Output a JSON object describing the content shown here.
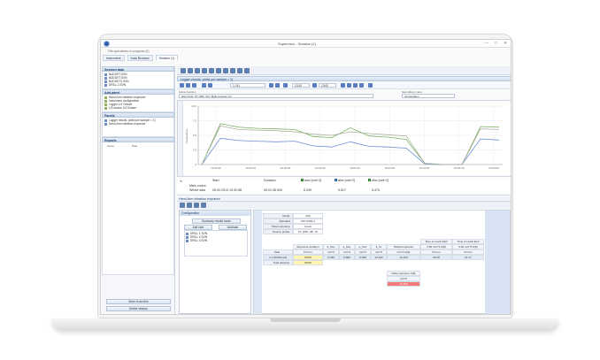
{
  "app": {
    "title": "Supervisor - Session (1)",
    "subtitle": "File operations in progress (0)",
    "tabs": [
      "Instrument",
      "Data Browser",
      "Session (1)"
    ],
    "active_tab": 2
  },
  "sidebar": {
    "session_data": {
      "title": "Session data",
      "items": [
        "BUDGET.SVN",
        "BUDGET.SVN",
        "BUDGET2.SVN",
        "DRILL 2.SVN"
      ]
    },
    "add_panel": {
      "title": "Add panel",
      "items": [
        "Hand-Arm vibration exposure",
        "Instrument configuration",
        "Logger 1/1 Octave",
        "1/3 octave 1/3 Octave"
      ]
    },
    "panels": {
      "title": "Panels",
      "items": [
        "Logger results, plotsi per sample = 1]",
        "Hand-Arm vibration exposure"
      ]
    },
    "reports": {
      "title": "Reports",
      "columns": [
        "Name",
        "Date"
      ]
    },
    "move_archive": "Move to archive",
    "delete_session": "Delete session"
  },
  "logger": {
    "title": "Logger results, plotsi per sample = 1]",
    "position": "1 / 81",
    "time_start": "13:30",
    "time_end": "13:00",
    "active_function_label": "Active function",
    "active_function": "ahw (CH1, PT (WR, Xh), Multi sources (1))",
    "secondary_label": "Secondary y axis",
    "secondary_value": "Acceleration"
  },
  "chart_data": {
    "type": "line",
    "x": [
      "10:03:30",
      "10:03:40",
      "10:03:50",
      "10:04:00",
      "10:04:10",
      "10:04:20",
      "10:04:30",
      "10:04:40",
      "10:04:50"
    ],
    "ylabel": "Acceleration",
    "yticks": [
      "10.0",
      "7.5",
      "5.0",
      "2.5",
      "0"
    ],
    "series": [
      {
        "name": "ahw (CH1)",
        "color": "#7ab36a",
        "values": [
          0.0,
          7.0,
          6.4,
          6.2,
          6.1,
          6.0,
          4.8,
          4.6,
          6.3,
          4.9,
          4.7,
          4.3,
          0.2,
          0.0,
          0.0,
          6.5,
          6.4
        ]
      },
      {
        "name": "ahw (CH2)",
        "color": "#6b8fd6",
        "values": [
          0.0,
          4.5,
          4.1,
          4.0,
          3.9,
          4.0,
          3.2,
          3.0,
          3.9,
          3.1,
          3.0,
          2.8,
          0.1,
          0.0,
          0.0,
          4.4,
          4.2
        ]
      },
      {
        "name": "ahw (CH3)",
        "color": "#aab09a",
        "values": [
          0.0,
          6.6,
          6.0,
          5.9,
          5.8,
          5.6,
          5.2,
          5.0,
          5.6,
          5.3,
          5.1,
          4.9,
          0.2,
          0.0,
          0.0,
          6.1,
          6.0
        ]
      }
    ]
  },
  "cursor_table": {
    "headers": [
      "Start",
      "Duration",
      "ahw [m/s^2]",
      "ahw [m/s^2]",
      "ahw [m/s^2]"
    ],
    "main_cursor_label": "Main cursor",
    "whole_data_label": "Whole data",
    "whole_data": [
      "26.09.2013 10:02:58",
      "00:01:38.000",
      "5.339",
      "9.817",
      "5.470"
    ]
  },
  "hand_arm": {
    "title": "Hand-Arm vibration exposure",
    "config_tab": "Configuration",
    "summary_label": "Summary results mode",
    "add_user": "Add user",
    "add_task": "Add task",
    "tasks": [
      "DRILL 1.SVN",
      "DRILL 2.SVN",
      "DRILL 3.SVN"
    ]
  },
  "exposure_grid": {
    "mode_label": "Mode:",
    "mode_value": "A(8)",
    "standard_label": "Standard",
    "standard_value": "ISO 5349-2",
    "show_exposure_label": "Show exposure",
    "show_exposure_value": "levels",
    "source_profile_label": "Source profile:",
    "source_profile_value": "P1 (WR, Wh, W",
    "task_label": "Task",
    "total_duration_label": "Total duration:",
    "col_headers": [
      "Exposure duration",
      "a_hwx",
      "a_hwy",
      "a_hwz",
      "a_hv",
      "Partial exposure",
      "Time to reach EAV",
      "Time to reach ELV"
    ],
    "col_units": [
      "hh:mm",
      "m/s^2",
      "m/s^2",
      "m/s^2",
      "m/s^2",
      "m/s^2 A(8)",
      "2.50 m/s^2 A(8)",
      "5.00 m/s^2 A(8)"
    ],
    "col_units2": [
      "",
      "",
      "",
      "",
      "",
      "",
      "hh:mm",
      "hh:mm"
    ],
    "row_task": "1.1 [DrillFixed]",
    "row_values": [
      "08:00",
      "5.339",
      "9.809",
      "5.466",
      "12.432",
      "12.432",
      "00:18",
      "01:17"
    ],
    "total_duration": "08:00",
    "daily_label": "Daily exposure A(8)",
    "daily_unit": "m/s^2",
    "daily_value": "12.432"
  }
}
